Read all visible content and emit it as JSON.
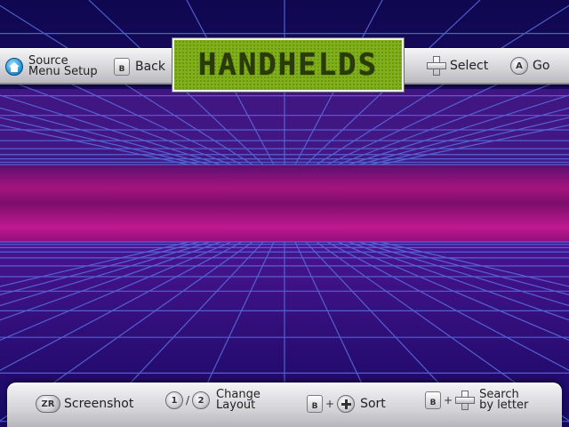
{
  "top_bar": {
    "home_label_line1": "Source",
    "home_label_line2": "Menu Setup",
    "back_key": "B",
    "back_label": "Back",
    "select_label": "Select",
    "go_key": "A",
    "go_label": "Go"
  },
  "title_panel": {
    "text": "HANDHELDS",
    "color": "#7fb01a"
  },
  "bottom_bar": {
    "screenshot_key": "ZR",
    "screenshot_label": "Screenshot",
    "layout_key1": "1",
    "layout_sep": "/",
    "layout_key2": "2",
    "layout_label_line1": "Change",
    "layout_label_line2": "Layout",
    "sort_key": "B",
    "sort_plus": "+",
    "sort_label": "Sort",
    "search_key": "B",
    "search_plus": "+",
    "search_label_line1": "Search",
    "search_label_line2": "by letter"
  },
  "colors": {
    "sky": "#1a0a5a",
    "horizon_band": "#c0188f",
    "grid": "#5a6fe0"
  },
  "icons": [
    "home-icon",
    "b-button-icon",
    "dpad-icon",
    "a-button-icon",
    "zr-button-icon",
    "button-1-icon",
    "button-2-icon",
    "plus-button-icon"
  ]
}
